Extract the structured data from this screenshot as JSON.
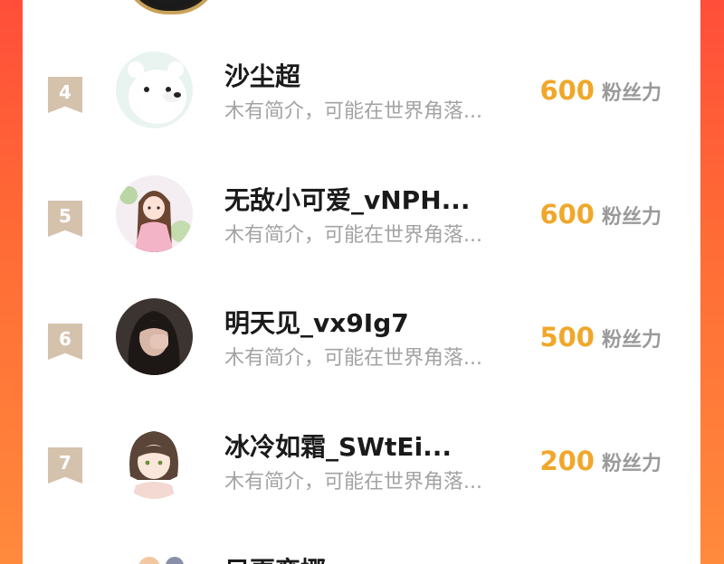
{
  "ranking": {
    "fans_label": "粉丝力",
    "rows": [
      {
        "rank": "4",
        "name": "沙尘超",
        "bio": "木有简介，可能在世界角落...",
        "fans": "600"
      },
      {
        "rank": "5",
        "name": "无敌小可爱_vNPH...",
        "bio": "木有简介，可能在世界角落...",
        "fans": "600"
      },
      {
        "rank": "6",
        "name": "明天见_vx9Ig7",
        "bio": "木有简介，可能在世界角落...",
        "fans": "500"
      },
      {
        "rank": "7",
        "name": "冰冷如霜_SWtEi...",
        "bio": "木有简介，可能在世界角落...",
        "fans": "200"
      }
    ],
    "partial_row_name": "只更变挪"
  },
  "colors": {
    "background_gradient_top": "#ff4e3a",
    "background_gradient_bottom": "#ff8a3c",
    "rank_badge": "#d5c2ad",
    "fans_count": "#f0a72a",
    "fans_label": "#9a9a9a",
    "bio": "#a3a3a3"
  },
  "icons": {
    "rank_badge": "ribbon-bookmark-icon"
  }
}
